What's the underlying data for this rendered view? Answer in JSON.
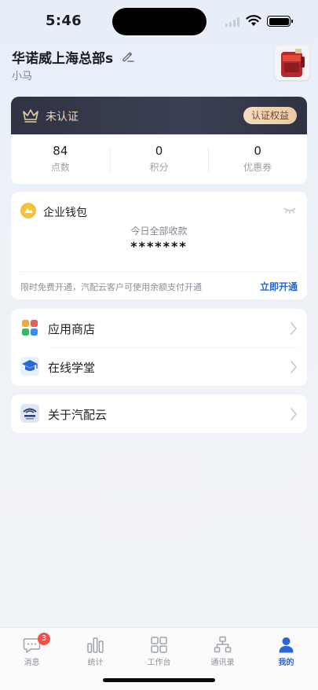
{
  "status_bar": {
    "time": "5:46"
  },
  "header": {
    "company_name": "华诺威上海总部s",
    "user_name": "小马"
  },
  "certification": {
    "status": "未认证",
    "benefits_button": "认证权益",
    "stats": [
      {
        "value": "84",
        "label": "点数"
      },
      {
        "value": "0",
        "label": "积分"
      },
      {
        "value": "0",
        "label": "优惠券"
      }
    ]
  },
  "wallet": {
    "title": "企业钱包",
    "subtitle": "今日全部收款",
    "amount": "*******",
    "note": "限时免费开通，汽配云客户可使用余额支付开通",
    "activate_link": "立即开通"
  },
  "menu": {
    "items": [
      {
        "label": "应用商店",
        "icon": "app-store-icon"
      },
      {
        "label": "在线学堂",
        "icon": "graduation-cap-icon"
      }
    ],
    "about": {
      "label": "关于汽配云",
      "icon": "company-logo-icon"
    }
  },
  "tab_bar": {
    "tabs": [
      {
        "label": "消息",
        "icon": "message-icon",
        "badge": "3"
      },
      {
        "label": "统计",
        "icon": "chart-icon"
      },
      {
        "label": "工作台",
        "icon": "grid-icon"
      },
      {
        "label": "通讯录",
        "icon": "org-chart-icon"
      },
      {
        "label": "我的",
        "icon": "person-icon",
        "active": true
      }
    ]
  },
  "colors": {
    "accent": "#2866d6",
    "gold": "#f0d7b4",
    "badge": "#f0504a"
  }
}
